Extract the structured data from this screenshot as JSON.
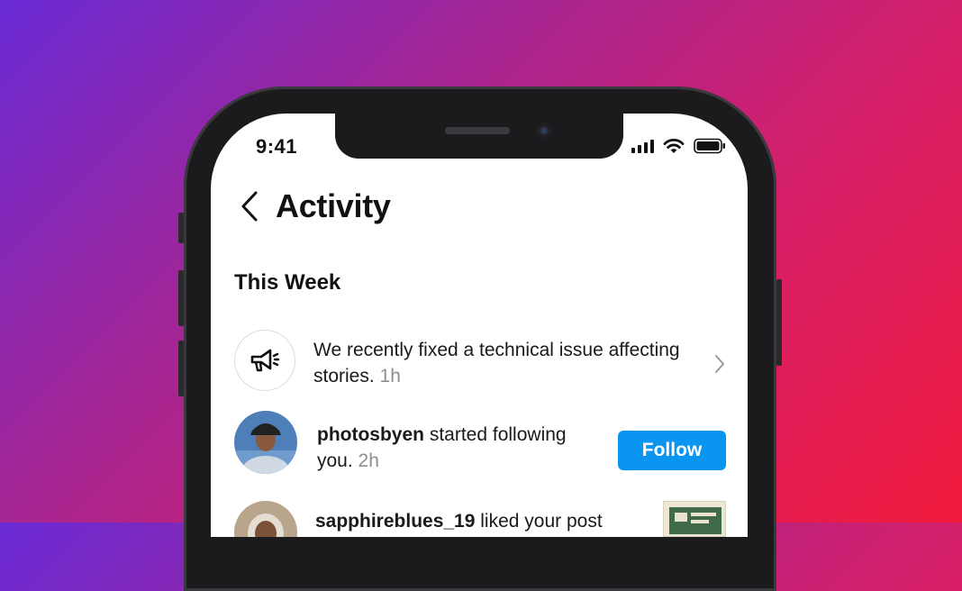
{
  "status_bar": {
    "time": "9:41"
  },
  "header": {
    "title": "Activity"
  },
  "section_title": "This Week",
  "notifications": [
    {
      "type": "announcement",
      "icon": "megaphone-icon",
      "text": "We recently fixed a technical issue affecting stories.",
      "time": "1h"
    },
    {
      "type": "follow",
      "username": "photosbyen",
      "action": "started following you.",
      "time": "2h",
      "button_label": "Follow"
    },
    {
      "type": "like",
      "username": "sapphireblues_19",
      "action": "liked your post"
    }
  ],
  "colors": {
    "accent": "#0A95F0",
    "background_gradient": [
      "#6A2BD6",
      "#A42593",
      "#D41F6A",
      "#F01A3C"
    ],
    "muted_text": "#8E8E8E"
  }
}
